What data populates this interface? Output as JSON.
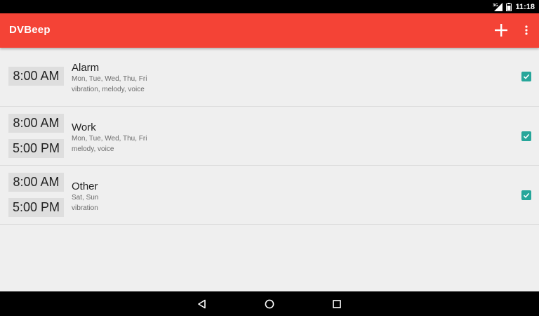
{
  "status_bar": {
    "signal_label": "3G",
    "time": "11:18",
    "icons": [
      "signal-icon",
      "battery-icon"
    ]
  },
  "app_bar": {
    "title": "DVBeep",
    "actions": [
      "add-icon",
      "overflow-menu-icon"
    ]
  },
  "alarms": [
    {
      "name": "Alarm",
      "times": [
        "8:00 AM"
      ],
      "days": "Mon, Tue, Wed, Thu, Fri",
      "options": "vibration, melody, voice",
      "enabled": true
    },
    {
      "name": "Work",
      "times": [
        "8:00 AM",
        "5:00 PM"
      ],
      "days": "Mon, Tue, Wed, Thu, Fri",
      "options": "melody, voice",
      "enabled": true
    },
    {
      "name": "Other",
      "times": [
        "8:00 AM",
        "5:00 PM"
      ],
      "days": "Sat, Sun",
      "options": "vibration",
      "enabled": true
    }
  ],
  "nav_bar": {
    "buttons": [
      "back-icon",
      "home-icon",
      "recents-icon"
    ]
  },
  "colors": {
    "app_bar": "#f44336",
    "checkbox": "#26a69a",
    "background": "#efefef",
    "time_box": "#dedede"
  }
}
